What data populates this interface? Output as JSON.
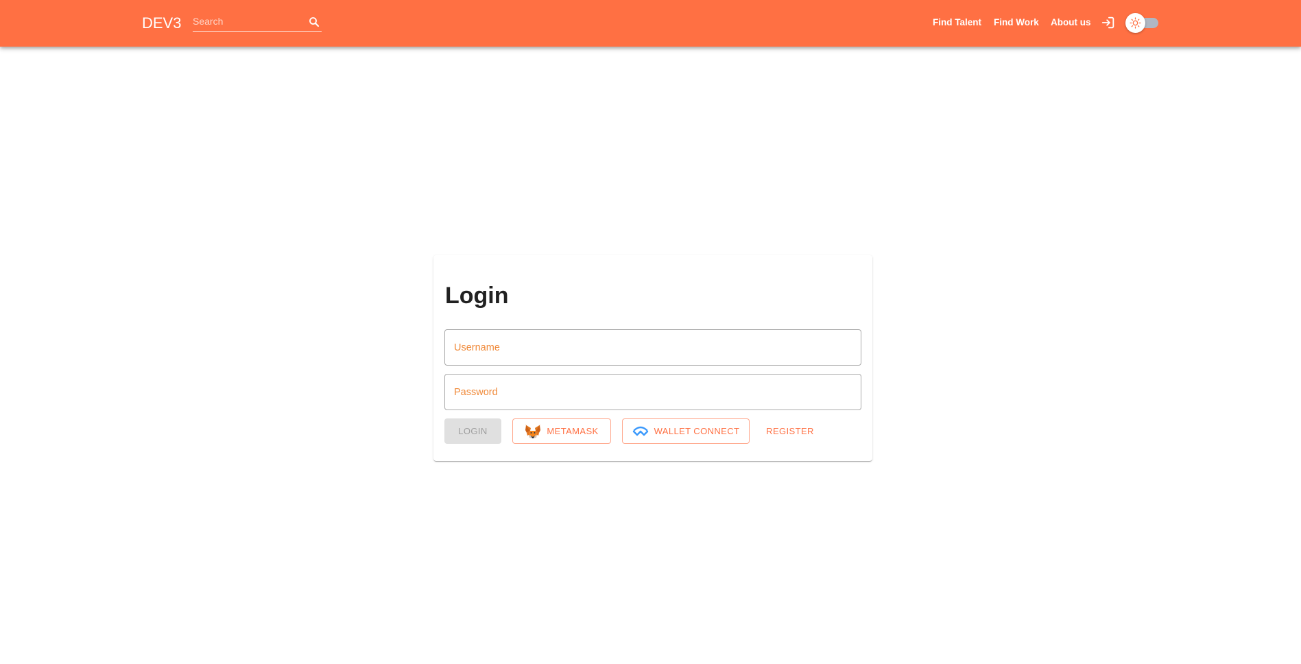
{
  "header": {
    "logo": "DEV3",
    "search_placeholder": "Search",
    "nav": [
      "Find Talent",
      "Find Work",
      "About us"
    ]
  },
  "login": {
    "title": "Login",
    "username_placeholder": "Username",
    "password_placeholder": "Password",
    "login_label": "LOGIN",
    "metamask_label": "METAMASK",
    "walletconnect_label": "WALLET CONNECT",
    "register_label": "REGISTER"
  },
  "theme": {
    "primary": "#ff7043",
    "accent_text": "#f08a3a",
    "disabled_bg": "#e0e0e0",
    "toggle_track": "#b0b7c3"
  },
  "icons": [
    "search-icon",
    "login-icon",
    "sun-icon",
    "metamask-fox-icon",
    "walletconnect-icon"
  ]
}
